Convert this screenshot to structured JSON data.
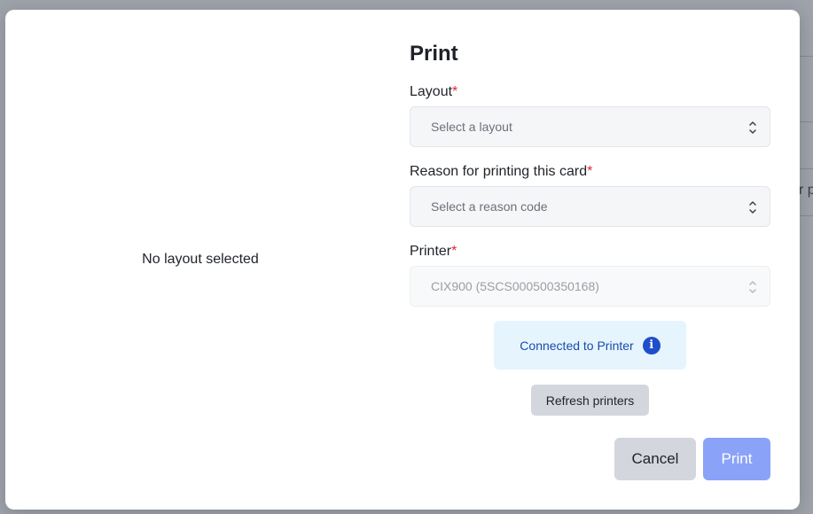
{
  "background": {
    "fragment_text": "r p",
    "dot_text": "·"
  },
  "dialog": {
    "title": "Print",
    "preview_empty_text": "No layout selected",
    "layout": {
      "label": "Layout",
      "required_mark": "*",
      "placeholder": "Select a layout"
    },
    "reason": {
      "label": "Reason for printing this card",
      "required_mark": "*",
      "placeholder": "Select a reason code"
    },
    "printer": {
      "label": "Printer",
      "required_mark": "*",
      "value": "CIX900 (5SCS000500350168)",
      "disabled": true
    },
    "status": {
      "text": "Connected to Printer",
      "icon": "info-icon",
      "icon_glyph": "i"
    },
    "refresh_label": "Refresh printers",
    "cancel_label": "Cancel",
    "print_label": "Print"
  },
  "colors": {
    "primary_disabled": "#8aa2f8",
    "info_bg": "#e6f4fe",
    "info_text": "#1a4ba8",
    "required": "#e0243b"
  }
}
